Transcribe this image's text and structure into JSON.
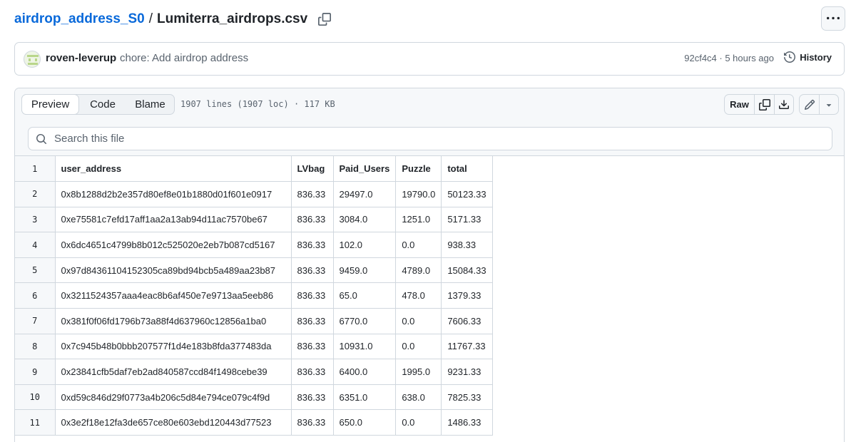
{
  "breadcrumb": {
    "repo": "airdrop_address_S0",
    "separator": "/",
    "file": "Lumiterra_airdrops.csv"
  },
  "commit": {
    "author": "roven-leverup",
    "message": "chore: Add airdrop address",
    "meta": "92cf4c4 · 5 hours ago",
    "history_label": "History"
  },
  "file": {
    "tabs": [
      "Preview",
      "Code",
      "Blame"
    ],
    "active_tab": "Preview",
    "info": "1907 lines (1907 loc) · 117 KB",
    "raw_label": "Raw"
  },
  "search": {
    "placeholder": "Search this file"
  },
  "table": {
    "header_line": "1",
    "columns": [
      "user_address",
      "LVbag",
      "Paid_Users",
      "Puzzle",
      "total"
    ],
    "rows": [
      {
        "line": "2",
        "cells": [
          "0x8b1288d2b2e357d80ef8e01b1880d01f601e0917",
          "836.33",
          "29497.0",
          "19790.0",
          "50123.33"
        ]
      },
      {
        "line": "3",
        "cells": [
          "0xe75581c7efd17aff1aa2a13ab94d11ac7570be67",
          "836.33",
          "3084.0",
          "1251.0",
          "5171.33"
        ]
      },
      {
        "line": "4",
        "cells": [
          "0x6dc4651c4799b8b012c525020e2eb7b087cd5167",
          "836.33",
          "102.0",
          "0.0",
          "938.33"
        ]
      },
      {
        "line": "5",
        "cells": [
          "0x97d84361104152305ca89bd94bcb5a489aa23b87",
          "836.33",
          "9459.0",
          "4789.0",
          "15084.33"
        ]
      },
      {
        "line": "6",
        "cells": [
          "0x3211524357aaa4eac8b6af450e7e9713aa5eeb86",
          "836.33",
          "65.0",
          "478.0",
          "1379.33"
        ]
      },
      {
        "line": "7",
        "cells": [
          "0x381f0f06fd1796b73a88f4d637960c12856a1ba0",
          "836.33",
          "6770.0",
          "0.0",
          "7606.33"
        ]
      },
      {
        "line": "8",
        "cells": [
          "0x7c945b48b0bbb207577f1d4e183b8fda377483da",
          "836.33",
          "10931.0",
          "0.0",
          "11767.33"
        ]
      },
      {
        "line": "9",
        "cells": [
          "0x23841cfb5daf7eb2ad840587ccd84f1498cebe39",
          "836.33",
          "6400.0",
          "1995.0",
          "9231.33"
        ]
      },
      {
        "line": "10",
        "cells": [
          "0xd59c846d29f0773a4b206c5d84e794ce079c4f9d",
          "836.33",
          "6351.0",
          "638.0",
          "7825.33"
        ]
      },
      {
        "line": "11",
        "cells": [
          "0x3e2f18e12fa3de657ce80e603ebd120443d77523",
          "836.33",
          "650.0",
          "0.0",
          "1486.33"
        ]
      }
    ]
  },
  "colors": {
    "link": "#0969da",
    "border": "#d0d7de",
    "muted": "#59636e",
    "subtle_bg": "#f6f8fa"
  },
  "icons": [
    "copy-icon",
    "kebab-icon",
    "history-icon",
    "search-icon",
    "download-icon",
    "pencil-icon",
    "triangle-down-icon"
  ]
}
